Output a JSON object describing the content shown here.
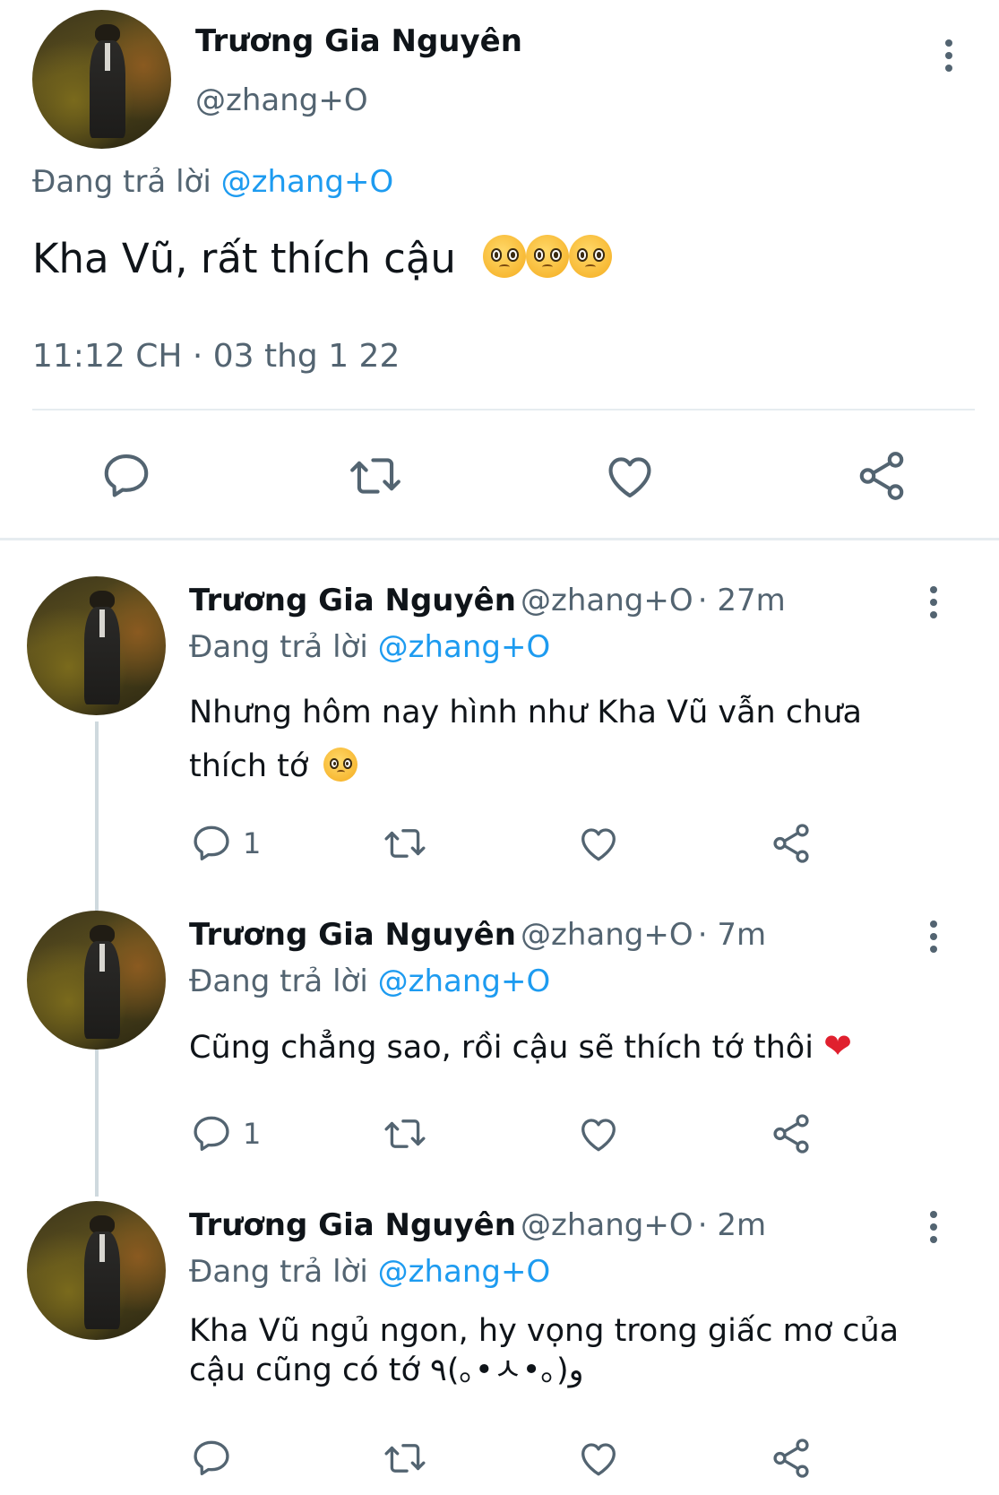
{
  "main_tweet": {
    "name": "Trương Gia Nguyên",
    "handle": "@zhang+O",
    "replying_label": "Đang trả lời",
    "replying_to": "@zhang+O",
    "text": "Kha Vũ, rất thích cậu",
    "emoji": [
      "pleading-face-emoji",
      "pleading-face-emoji",
      "pleading-face-emoji"
    ],
    "timestamp": "11:12 CH · 03 thg 1 22"
  },
  "replies": [
    {
      "name": "Trương Gia Nguyên",
      "handle": "@zhang+O",
      "time": "· 27m",
      "replying_label": "Đang trả lời",
      "replying_to": "@zhang+O",
      "text_line1": "Nhưng hôm nay hình như Kha Vũ vẫn chưa",
      "text_line2": "thích tớ",
      "emoji": "pleading-face-emoji",
      "reply_count": "1"
    },
    {
      "name": "Trương Gia Nguyên",
      "handle": "@zhang+O",
      "time": "· 7m",
      "replying_label": "Đang trả lời",
      "replying_to": "@zhang+O",
      "text": "Cũng chẳng sao, rồi cậu sẽ thích tớ thôi",
      "emoji_char": "❤",
      "reply_count": "1"
    },
    {
      "name": "Trương Gia Nguyên",
      "handle": "@zhang+O",
      "time": "· 2m",
      "replying_label": "Đang trả lời",
      "replying_to": "@zhang+O",
      "text_line1": "Kha Vũ ngủ ngon, hy vọng trong giấc mơ của",
      "text_line2": "cậu cũng có tớ ٩(｡•ㅅ•｡)و",
      "reply_count": ""
    }
  ],
  "colors": {
    "link": "#1d9bf0",
    "muted": "#536471",
    "text": "#0f1419",
    "thread_line": "#cfd9de"
  },
  "icons": [
    "more-icon",
    "reply-icon",
    "retweet-icon",
    "like-icon",
    "share-icon"
  ]
}
